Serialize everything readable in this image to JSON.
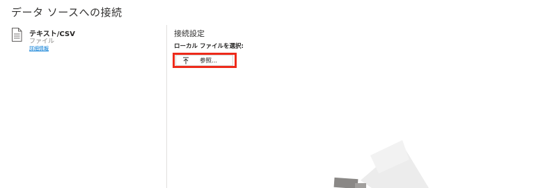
{
  "title": "データ ソースへの接続",
  "source": {
    "name": "テキスト/CSV",
    "type": "ファイル",
    "details_link": "詳細情報",
    "icon": "document-icon"
  },
  "settings": {
    "heading": "接続設定",
    "file_label": "ローカル ファイルを選択:",
    "browse_button": "参照...",
    "browse_icon": "upload-icon"
  },
  "colors": {
    "highlight": "#ee2a1a",
    "link": "#0078d4",
    "divider": "#e1dfdd"
  }
}
